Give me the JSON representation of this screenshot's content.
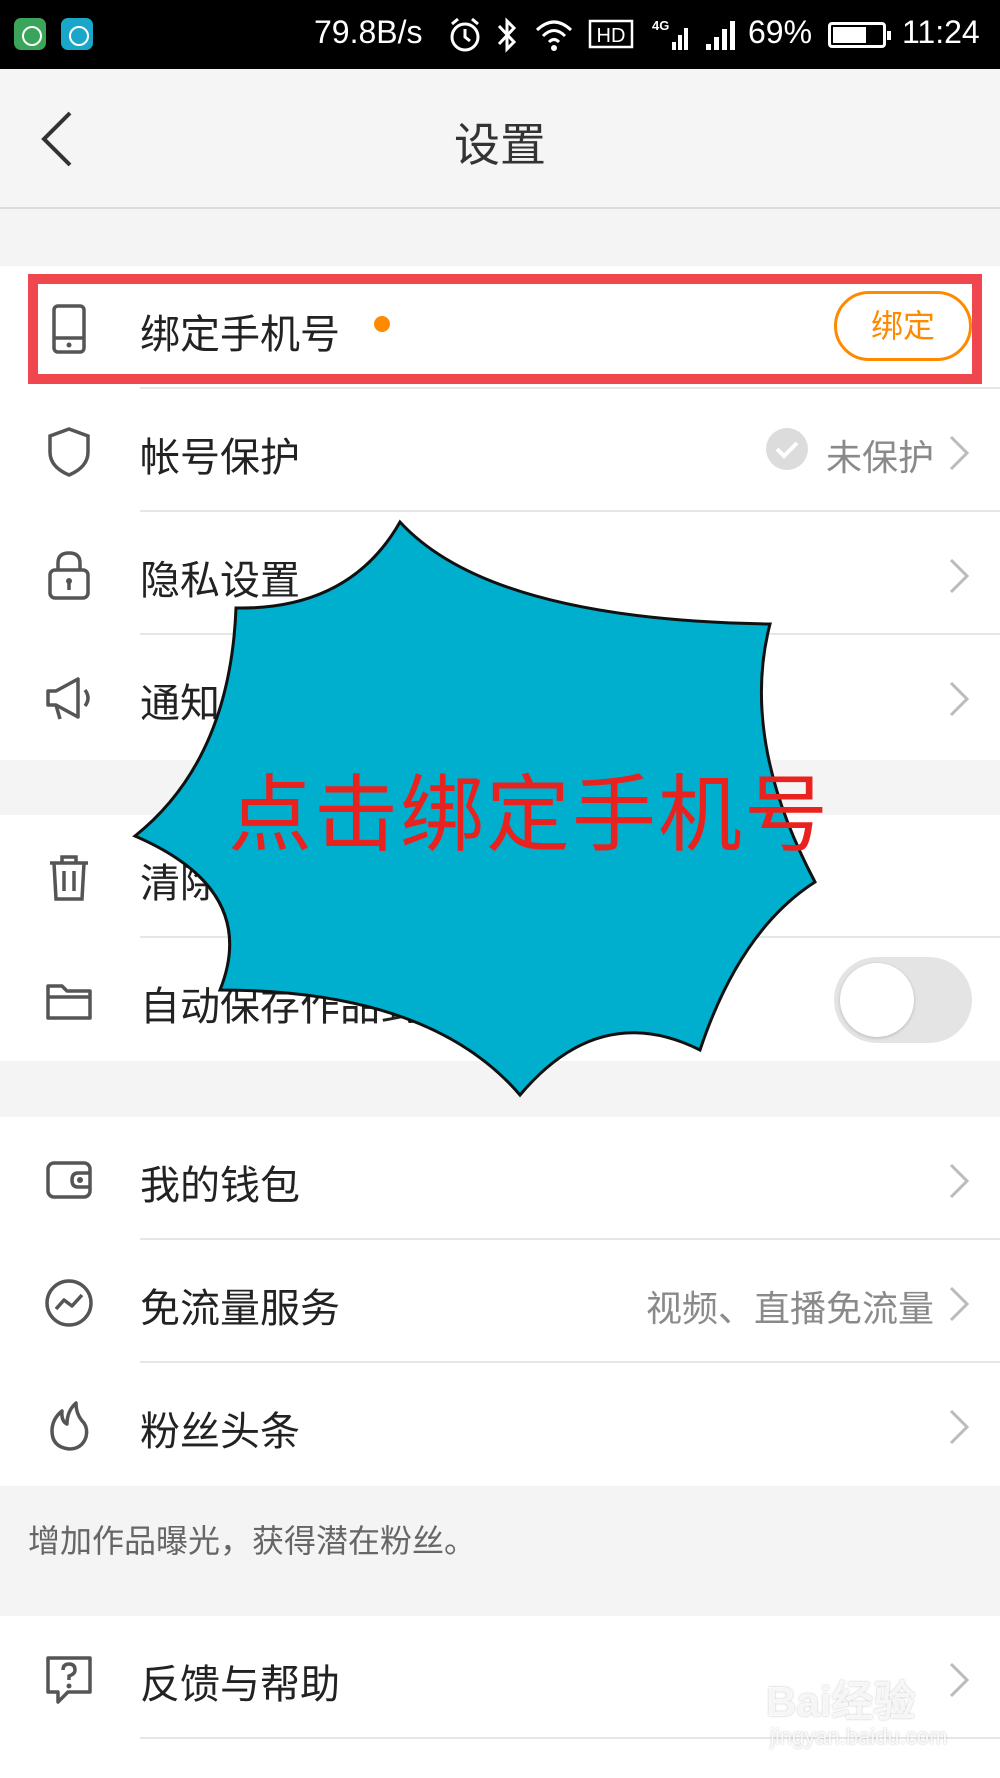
{
  "status_bar": {
    "speed": "79.8B/s",
    "battery_pct": "69%",
    "battery_level": 0.69,
    "time": "11:24",
    "icons": [
      "app-icon",
      "app-icon",
      "alarm-icon",
      "bluetooth-icon",
      "wifi-icon",
      "hd-icon",
      "4g-signal-icon",
      "signal-icon",
      "battery-icon"
    ]
  },
  "header": {
    "title": "设置",
    "back_icon": "back-chevron-icon"
  },
  "section1": {
    "items": [
      {
        "label": "绑定手机号",
        "icon": "phone-icon",
        "button": "绑定"
      },
      {
        "label": "帐号保护",
        "icon": "shield-icon",
        "value": "未保护"
      },
      {
        "label": "隐私设置",
        "icon": "lock-icon"
      },
      {
        "label": "通知设置",
        "icon": "megaphone-icon"
      }
    ]
  },
  "section2": {
    "items": [
      {
        "label": "清除缓存",
        "icon": "trash-icon"
      },
      {
        "label": "自动保存作品到相册",
        "icon": "folder-icon",
        "toggle_on": false
      }
    ]
  },
  "section3": {
    "items": [
      {
        "label": "我的钱包",
        "icon": "wallet-icon"
      },
      {
        "label": "免流量服务",
        "icon": "trend-icon",
        "value": "视频、直播免流量"
      },
      {
        "label": "粉丝头条",
        "icon": "flame-icon"
      }
    ],
    "footnote": "增加作品曝光，获得潜在粉丝。"
  },
  "section4": {
    "items": [
      {
        "label": "反馈与帮助",
        "icon": "question-icon"
      }
    ]
  },
  "annotation": {
    "callout_text": "点击绑定手机号",
    "callout_color": "#e8221f",
    "burst_color": "#00aecd",
    "highlight_color": "#f0474e"
  },
  "watermark": {
    "brand": "Bai经验",
    "url": "jingyan.baidu.com"
  },
  "colors": {
    "accent": "#ff8a00",
    "background": "#f4f4f4"
  }
}
